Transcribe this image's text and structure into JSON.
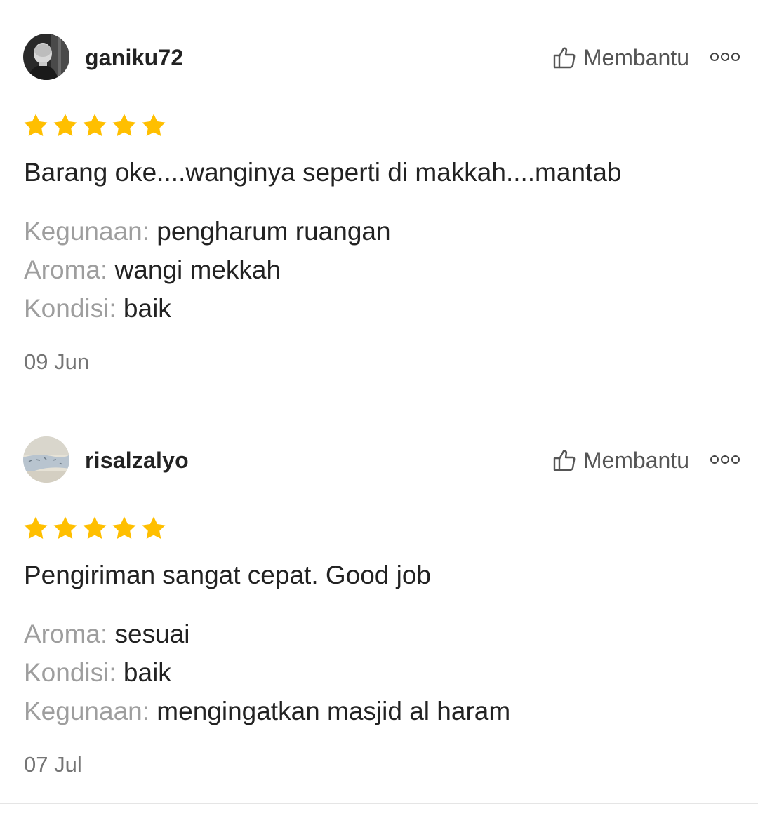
{
  "reviews": [
    {
      "username": "ganiku72",
      "helpful_label": "Membantu",
      "rating": 5,
      "text": "Barang oke....wanginya seperti di makkah....mantab",
      "attributes": [
        {
          "key": "Kegunaan:",
          "value": "pengharum ruangan"
        },
        {
          "key": "Aroma:",
          "value": "wangi mekkah"
        },
        {
          "key": "Kondisi:",
          "value": "baik"
        }
      ],
      "date": "09 Jun"
    },
    {
      "username": "risalzalyo",
      "helpful_label": "Membantu",
      "rating": 5,
      "text": "Pengiriman sangat cepat. Good job",
      "attributes": [
        {
          "key": "Aroma:",
          "value": "sesuai"
        },
        {
          "key": "Kondisi:",
          "value": "baik"
        },
        {
          "key": "Kegunaan:",
          "value": "mengingatkan masjid al haram"
        }
      ],
      "date": "07 Jul"
    }
  ],
  "colors": {
    "star": "#FFBF00",
    "attribute_key": "#9E9E9E",
    "text": "#222222",
    "divider": "#E5E5E5"
  },
  "icons": {
    "helpful": "thumbs-up-outline-icon",
    "more": "more-options-icon",
    "star": "star-filled-icon"
  }
}
